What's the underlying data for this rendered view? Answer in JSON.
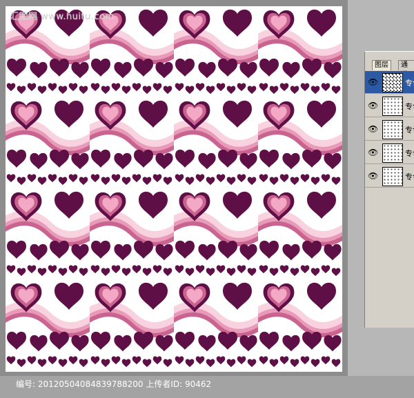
{
  "canvas": {
    "watermark": "汇图网 www.huitu.com"
  },
  "footer": {
    "text": "编号: 20120504084839788200 上传者ID: 90462"
  },
  "layers_panel": {
    "tabs": [
      {
        "label": "图层"
      },
      {
        "label": "通道"
      }
    ],
    "layers": [
      {
        "name": "专色",
        "selected": true
      },
      {
        "name": "专色",
        "selected": false
      },
      {
        "name": "专色",
        "selected": false
      },
      {
        "name": "专色",
        "selected": false
      },
      {
        "name": "专色",
        "selected": false
      }
    ]
  },
  "colors": {
    "heart_dark": "#5e0f45",
    "heart_pink": "#f3a8c6",
    "heart_mid": "#c9638f",
    "stripe_light": "#f8d2de",
    "background": "#ffffff"
  }
}
